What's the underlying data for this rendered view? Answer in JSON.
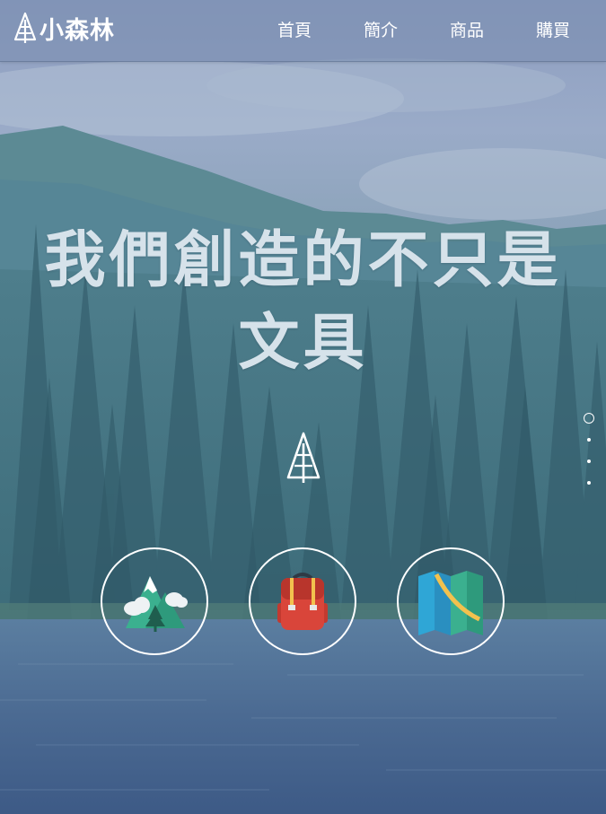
{
  "brand": {
    "name": "小森林",
    "logo_icon": "tree-icon"
  },
  "nav": {
    "items": [
      {
        "label": "首頁"
      },
      {
        "label": "簡介"
      },
      {
        "label": "商品"
      },
      {
        "label": "購買"
      }
    ]
  },
  "hero": {
    "title_line1": "我們創造的不只是",
    "title_line2": "文具",
    "icon": "tree-outline-icon"
  },
  "slider": {
    "total": 4,
    "active": 1
  },
  "features": [
    {
      "icon": "mountain-icon"
    },
    {
      "icon": "backpack-icon"
    },
    {
      "icon": "map-icon"
    }
  ],
  "colors": {
    "nav_bg": "#7e8db0",
    "title": "#d6e2ea",
    "mountain_green": "#3bb08f",
    "backpack_red": "#d9453a",
    "map_blue": "#2fa6d6",
    "map_yellow": "#f2c14e"
  }
}
